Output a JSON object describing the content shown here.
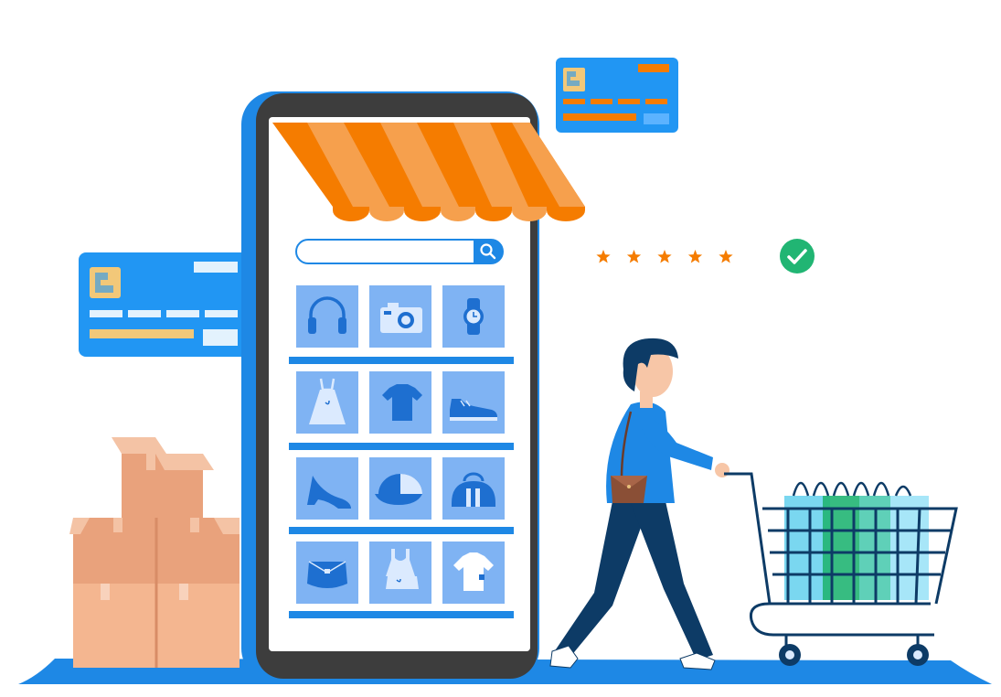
{
  "rating": {
    "stars": 5,
    "max": 5
  },
  "colors": {
    "primary_blue": "#1e88e5",
    "light_blue": "#7fb8f5",
    "tile_blue": "#6fa8f0",
    "shelf_blue": "#1e88e5",
    "awning_orange": "#f57c00",
    "awning_light": "#f6a04d",
    "check_green": "#21b573",
    "star_orange": "#f57c00",
    "box_tan": "#e9a27c",
    "box_light": "#f4c3a5",
    "navy": "#0d3b66"
  },
  "product_tiles": [
    {
      "icon": "headphones-icon"
    },
    {
      "icon": "camera-icon"
    },
    {
      "icon": "watch-icon"
    },
    {
      "icon": "dress-icon"
    },
    {
      "icon": "t-shirt-icon"
    },
    {
      "icon": "shoe-icon"
    },
    {
      "icon": "high-heel-icon"
    },
    {
      "icon": "cap-icon"
    },
    {
      "icon": "duffel-bag-icon"
    },
    {
      "icon": "purse-icon"
    },
    {
      "icon": "tank-top-icon"
    },
    {
      "icon": "shirt-icon"
    }
  ]
}
